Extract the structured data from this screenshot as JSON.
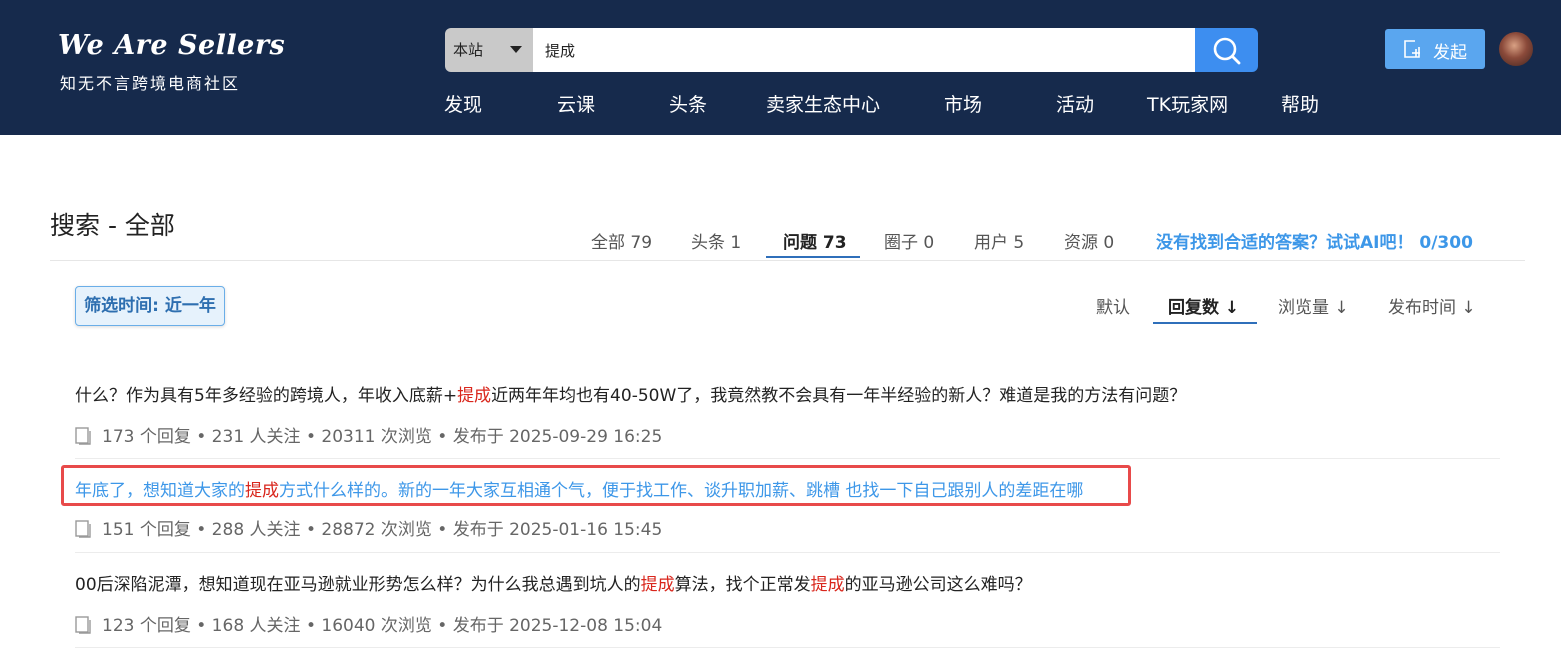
{
  "header": {
    "logo_title": "We Are Sellers",
    "logo_subtitle": "知无不言跨境电商社区",
    "search": {
      "scope": "本站",
      "value": "提成"
    },
    "nav": [
      "发现",
      "云课",
      "头条",
      "卖家生态中心",
      "市场",
      "活动",
      "TK玩家网",
      "帮助"
    ],
    "post_button": "发起"
  },
  "search_page": {
    "title": "搜索 - 全部",
    "tabs": [
      {
        "label": "全部 79"
      },
      {
        "label": "头条 1"
      },
      {
        "label": "问题 73",
        "active": true
      },
      {
        "label": "圈子 0"
      },
      {
        "label": "用户 5"
      },
      {
        "label": "资源 0"
      }
    ],
    "ai_link": "没有找到合适的答案？试试AI吧！ 0/300"
  },
  "filter": {
    "label": "筛选时间: 近一年"
  },
  "sort": [
    {
      "label": "默认"
    },
    {
      "label": "回复数 ↓",
      "active": true
    },
    {
      "label": "浏览量 ↓"
    },
    {
      "label": "发布时间 ↓"
    }
  ],
  "results": [
    {
      "title_parts": [
        "什么？作为具有5年多经验的跨境人，年收入底薪+",
        "提成",
        "近两年年均也有40-50W了，我竟然教不会具有一年半经验的新人？难道是我的方法有问题？"
      ],
      "meta": "173 个回复 • 231 人关注 • 20311 次浏览 • 发布于 2025-09-29 16:25"
    },
    {
      "title_parts": [
        "年底了，想知道大家的",
        "提成",
        "方式什么样的。新的一年大家互相通个气，便于找工作、谈升职加薪、跳槽 也找一下自己跟别人的差距在哪"
      ],
      "meta": "151 个回复 • 288 人关注 • 28872 次浏览 • 发布于 2025-01-16 15:45",
      "highlighted": true
    },
    {
      "title_parts": [
        "00后深陷泥潭，想知道现在亚马逊就业形势怎么样？为什么我总遇到坑人的",
        "提成",
        "算法，找个正常发",
        "提成",
        "的亚马逊公司这么难吗？"
      ],
      "meta": "123 个回复 • 168 人关注 • 16040 次浏览 • 发布于 2025-12-08 15:04"
    }
  ],
  "colors": {
    "header_bg": "#162a4c",
    "accent": "#3d8ef0",
    "keyword": "#d9261c",
    "link": "#3d97e8",
    "highlight_border": "#e84a4a"
  }
}
